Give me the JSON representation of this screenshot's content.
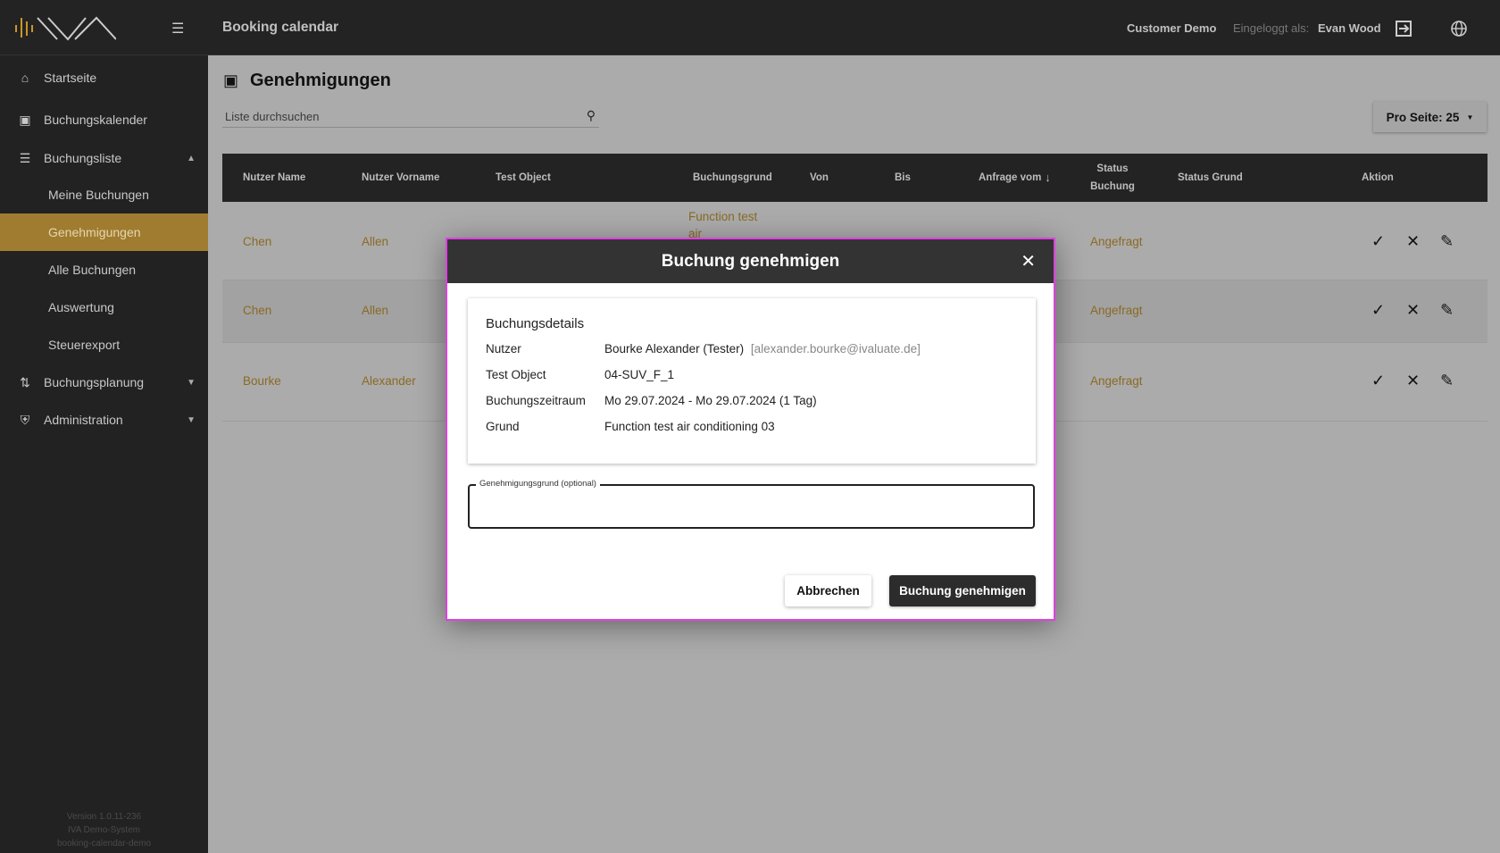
{
  "header": {
    "app_title": "Booking calendar",
    "customer": "Customer Demo",
    "logged_in_label": "Eingeloggt als:",
    "user": "Evan Wood"
  },
  "sidebar": {
    "items": [
      {
        "label": "Startseite",
        "icon": "home-icon"
      },
      {
        "label": "Buchungskalender",
        "icon": "calendar-icon"
      },
      {
        "label": "Buchungsliste",
        "icon": "list-icon",
        "expanded": true
      },
      {
        "label": "Buchungsplanung",
        "icon": "planning-icon"
      },
      {
        "label": "Administration",
        "icon": "shield-icon"
      }
    ],
    "subitems": [
      {
        "label": "Meine Buchungen"
      },
      {
        "label": "Genehmigungen",
        "active": true
      },
      {
        "label": "Alle Buchungen"
      },
      {
        "label": "Auswertung"
      },
      {
        "label": "Steuerexport"
      }
    ],
    "footer": [
      "Version 1.0.11-236",
      "IVA Demo-System",
      "booking-calendar-demo"
    ]
  },
  "page": {
    "title": "Genehmigungen",
    "search_placeholder": "Liste durchsuchen",
    "per_page": "Pro Seite: 25"
  },
  "table": {
    "columns": [
      "Nutzer Name",
      "Nutzer Vorname",
      "Test Object",
      "Buchungsgrund",
      "Von",
      "Bis",
      "Anfrage vom",
      "Status Buchung",
      "Status Grund",
      "Aktion"
    ],
    "rows": [
      {
        "name": "Chen",
        "vorname": "Allen",
        "grund": "Function test air",
        "status": "Angefragt"
      },
      {
        "name": "Chen",
        "vorname": "Allen",
        "grund": "",
        "status": "Angefragt"
      },
      {
        "name": "Bourke",
        "vorname": "Alexander",
        "grund": "",
        "status": "Angefragt"
      }
    ]
  },
  "modal": {
    "title": "Buchung genehmigen",
    "details_title": "Buchungsdetails",
    "details": [
      {
        "label": "Nutzer",
        "value": "Bourke Alexander (Tester)",
        "extra": "[alexander.bourke@ivaluate.de]"
      },
      {
        "label": "Test Object",
        "value": "04-SUV_F_1"
      },
      {
        "label": "Buchungszeitraum",
        "value": "Mo 29.07.2024 - Mo 29.07.2024 (1 Tag)"
      },
      {
        "label": "Grund",
        "value": "Function test air conditioning 03"
      }
    ],
    "field_label": "Genehmigungsgrund (optional)",
    "field_value": "",
    "cancel": "Abbrechen",
    "confirm": "Buchung genehmigen"
  },
  "colors": {
    "accent": "#a07c30",
    "dark": "#232323",
    "modal_border": "#e040e0"
  }
}
